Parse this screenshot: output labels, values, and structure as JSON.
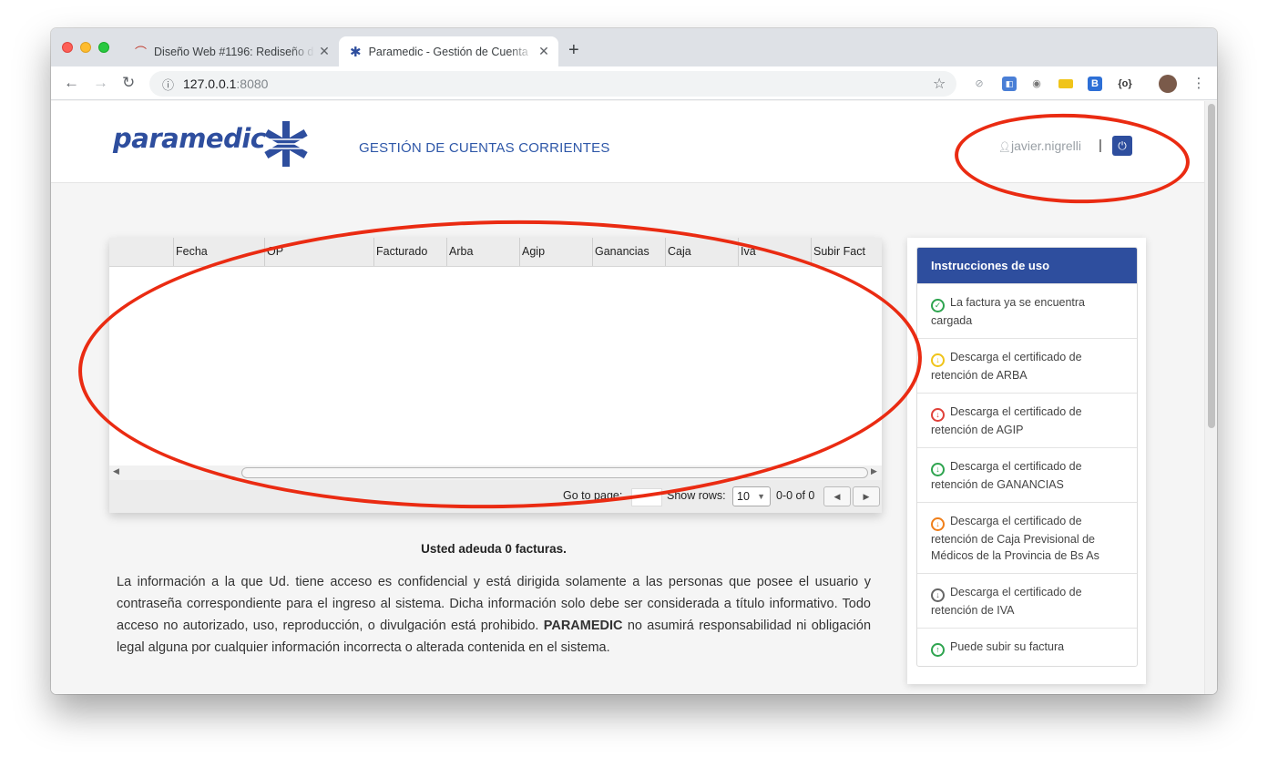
{
  "browser": {
    "tabs": [
      {
        "title": "Diseño Web #1196: Rediseño d",
        "active": false,
        "icon": "cloud-gauge-icon"
      },
      {
        "title": "Paramedic - Gestión de Cuenta",
        "active": true,
        "icon": "asterisk-logo-icon"
      }
    ],
    "close_glyph": "✕",
    "newtab_glyph": "+",
    "url_host": "127.0.0.1",
    "url_port": ":8080",
    "extensions": [
      "check-icon",
      "translate-icon",
      "camera-icon",
      "ruler-icon",
      "b-icon",
      "braces-icon",
      "avatar-icon"
    ]
  },
  "header": {
    "logo_text": "paramedic",
    "title": "GESTIÓN DE CUENTAS CORRIENTES",
    "user": "javier.nigrelli",
    "separator": "|"
  },
  "grid": {
    "columns": [
      "",
      "Fecha",
      "OP",
      "Facturado",
      "Arba",
      "Agip",
      "Ganancias",
      "Caja",
      "Iva",
      "Subir Fact"
    ],
    "rows": [],
    "pager": {
      "goto_label": "Go to page:",
      "rows_label": "Show rows:",
      "rows_value": "10",
      "count": "0-0 of 0"
    }
  },
  "summary": "Usted adeuda 0 facturas.",
  "disclaimer": {
    "part1": "La información a la que Ud. tiene acceso es confidencial y está dirigida solamente a las personas que posee el usuario y contraseña correspondiente para el ingreso al sistema. Dicha información solo debe ser considerada a título informativo. Todo acceso no autorizado, uso, reproducción, o divulgación está prohibido. ",
    "brand": "PARAMEDIC",
    "part2": " no asumirá responsabilidad ni obligación legal alguna por cualquier información incorrecta o alterada contenida en el sistema."
  },
  "instructions": {
    "title": "Instrucciones de uso",
    "items": [
      {
        "text": "La factura ya se encuentra cargada",
        "icon": "check-circle-icon",
        "color": "#2ea44f"
      },
      {
        "text": "Descarga el certificado de retención de ARBA",
        "icon": "download-circle-icon",
        "color": "#f0c419"
      },
      {
        "text": "Descarga el certificado de retención de AGIP",
        "icon": "download-circle-icon",
        "color": "#e0413a"
      },
      {
        "text": "Descarga el certificado de retención de GANANCIAS",
        "icon": "download-circle-icon",
        "color": "#2ea44f"
      },
      {
        "text": "Descarga el certificado de retención de Caja Previsional de Médicos de la Provincia de Bs As",
        "icon": "download-circle-icon",
        "color": "#f07f1a"
      },
      {
        "text": "Descarga el certificado de retención de IVA",
        "icon": "download-circle-icon",
        "color": "#666666"
      },
      {
        "text": "Puede subir su factura",
        "icon": "upload-circle-icon",
        "color": "#2ea44f"
      }
    ]
  },
  "colors": {
    "brand": "#2e4e9e",
    "annotation": "#ea2b12"
  }
}
